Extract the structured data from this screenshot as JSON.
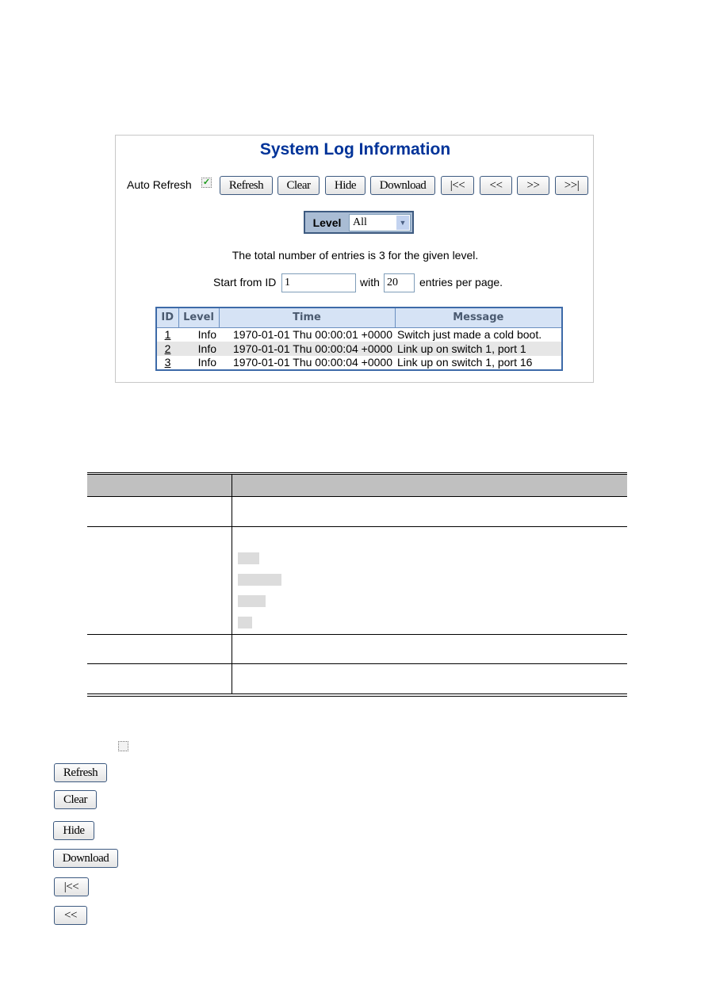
{
  "screenshot": {
    "title": "System Log Information",
    "auto_refresh_label": "Auto Refresh",
    "auto_refresh_checked": true,
    "buttons": [
      "Refresh",
      "Clear",
      "Hide",
      "Download",
      "|<<",
      "<<",
      ">>",
      ">>|"
    ],
    "level_label": "Level",
    "level_value": "All",
    "total_text": "The total number of entries is 3 for the given level.",
    "start_label": "Start from ID",
    "start_value": "1",
    "with_label": "with",
    "per_page_value": "20",
    "per_page_label": "entries per page.",
    "columns": [
      "ID",
      "Level",
      "Time",
      "Message"
    ],
    "rows": [
      {
        "id": "1",
        "level": "Info",
        "time": "1970-01-01 Thu 00:00:01 +0000",
        "message": "Switch just made a cold boot."
      },
      {
        "id": "2",
        "level": "Info",
        "time": "1970-01-01 Thu 00:00:04 +0000",
        "message": "Link up on switch 1, port 1"
      },
      {
        "id": "3",
        "level": "Info",
        "time": "1970-01-01 Thu 00:00:04 +0000",
        "message": "Link up on switch 1, port 16"
      }
    ]
  },
  "legend_buttons": [
    "Refresh",
    "Clear",
    "Hide",
    "Download",
    "|<<",
    "<<"
  ],
  "colors": {
    "title": "#003399",
    "table_border": "#3d6aa8",
    "header_bg": "#d6e3f5",
    "doc_header_bg": "#c0c0c0"
  }
}
